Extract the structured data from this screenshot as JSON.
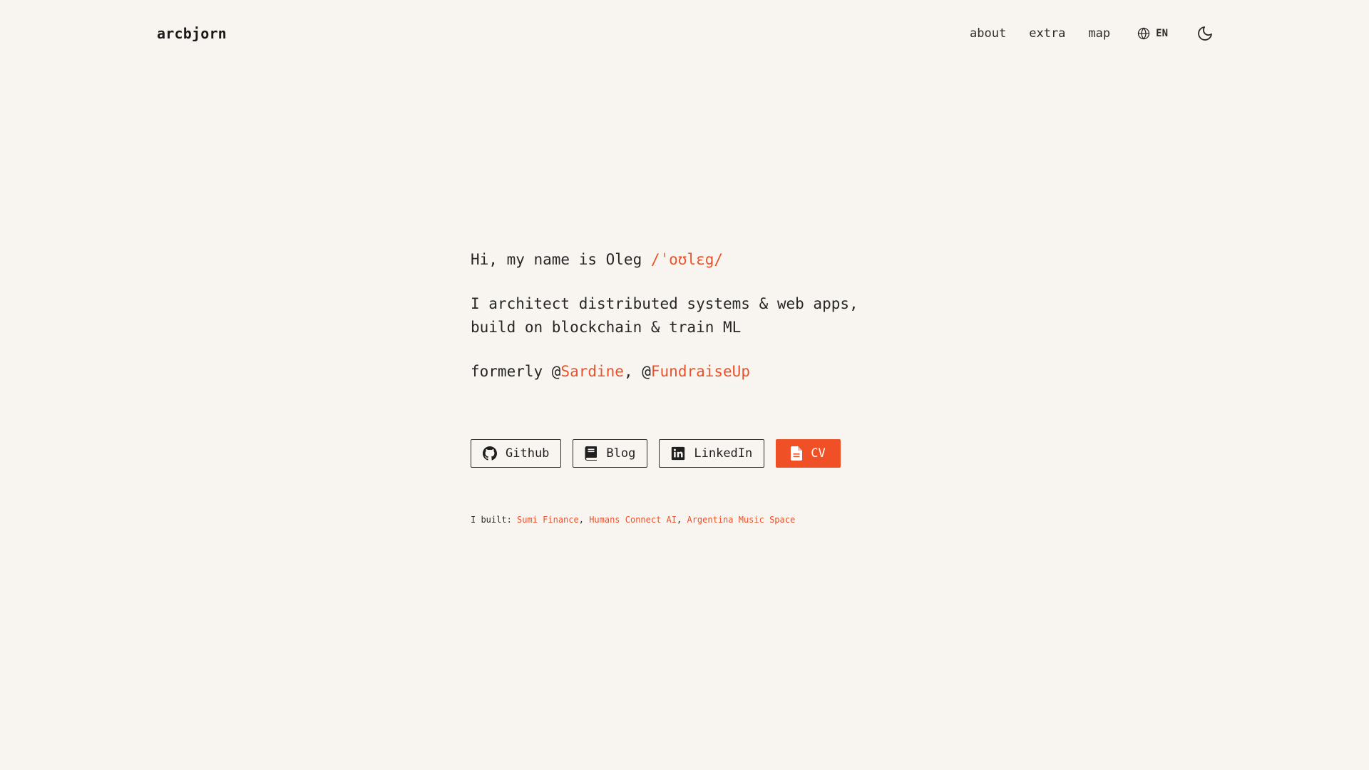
{
  "header": {
    "logo": "arcbjorn",
    "nav": {
      "about": "about",
      "extra": "extra",
      "map": "map"
    },
    "language": "EN",
    "globe_icon": "globe-icon",
    "theme_icon": "moon-icon"
  },
  "intro": {
    "greeting": "Hi, my name is Oleg ",
    "pronunciation": "/ˈoʊlɛg/",
    "description_line1": "I architect distributed systems & web apps,",
    "description_line2": "build on blockchain & train ML",
    "formerly_prefix": "formerly @",
    "company1": "Sardine",
    "separator": ", @",
    "company2": "FundraiseUp"
  },
  "links": {
    "github": {
      "label": "Github",
      "icon": "github-icon"
    },
    "blog": {
      "label": "Blog",
      "icon": "book-icon"
    },
    "linkedin": {
      "label": "LinkedIn",
      "icon": "linkedin-icon"
    },
    "cv": {
      "label": "CV",
      "icon": "document-icon"
    }
  },
  "built": {
    "prefix": "I built: ",
    "projects": [
      "Sumi Finance",
      "Humans Connect AI",
      "Argentina Music Space"
    ],
    "separator": ", "
  },
  "colors": {
    "background": "#f8f5f0",
    "accent": "#e9522b",
    "text": "#1f1f1f"
  }
}
